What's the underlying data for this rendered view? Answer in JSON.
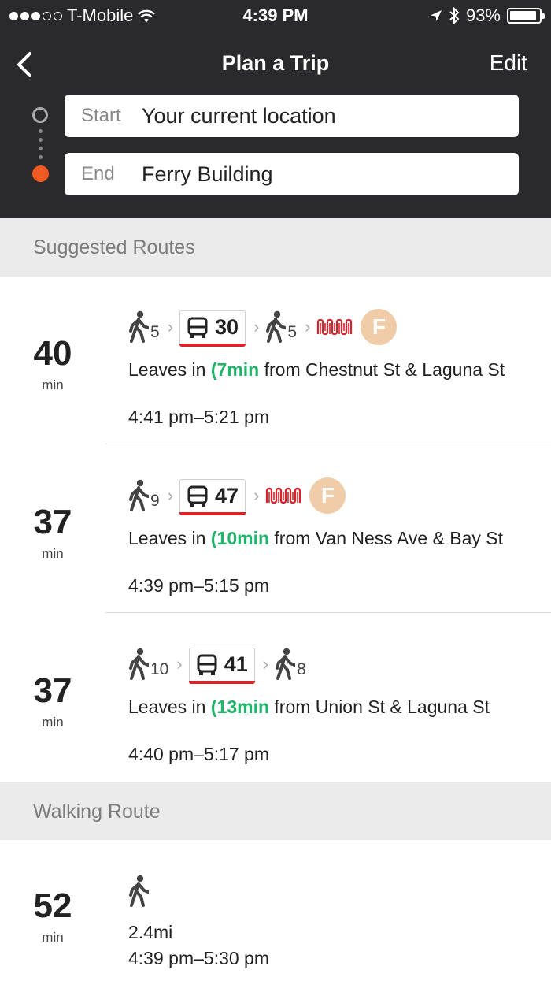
{
  "status_bar": {
    "carrier": "T-Mobile",
    "time": "4:39 PM",
    "battery": "93%",
    "battery_level": 0.93
  },
  "nav": {
    "title": "Plan a Trip",
    "edit": "Edit"
  },
  "trip": {
    "start_label": "Start",
    "start_value": "Your current location",
    "end_label": "End",
    "end_value": "Ferry Building"
  },
  "sections": {
    "suggested": "Suggested Routes",
    "walking": "Walking Route"
  },
  "routes": [
    {
      "duration": "40",
      "unit": "min",
      "walk1": "5",
      "bus": "30",
      "walk2": "5",
      "leaves_prefix": "Leaves in",
      "realtime": "7min",
      "from": "from Chestnut St & Laguna St",
      "time_range": "4:41 pm–5:21 pm"
    },
    {
      "duration": "37",
      "unit": "min",
      "walk1": "9",
      "bus": "47",
      "leaves_prefix": "Leaves in",
      "realtime": "10min",
      "from": "from Van Ness Ave & Bay St",
      "time_range": "4:39 pm–5:15 pm"
    },
    {
      "duration": "37",
      "unit": "min",
      "walk1": "10",
      "bus": "41",
      "walk2": "8",
      "leaves_prefix": "Leaves in",
      "realtime": "13min",
      "from": "from Union St & Laguna St",
      "time_range": "4:40 pm–5:17 pm"
    }
  ],
  "walking_route": {
    "duration": "52",
    "unit": "min",
    "distance": "2.4mi",
    "time_range": "4:39 pm–5:30 pm"
  },
  "badge_letter": "F",
  "colors": {
    "header_bg": "#2a2a2c",
    "accent_orange": "#f15a22",
    "realtime_green": "#21b56b",
    "muni_red": "#d8232a",
    "f_line_badge": "#f0cda8"
  }
}
